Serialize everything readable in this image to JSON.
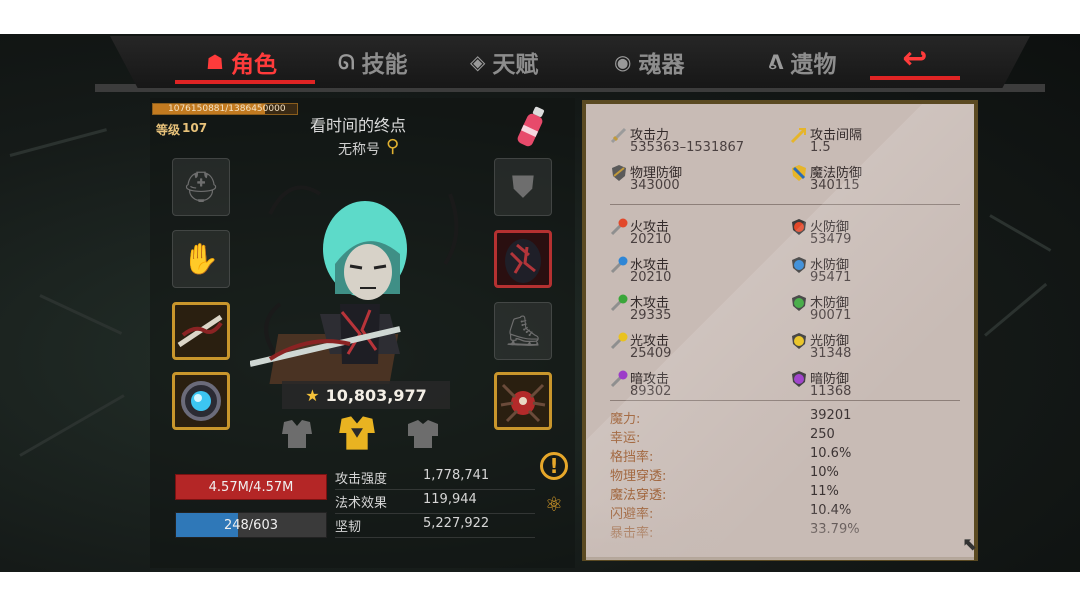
{
  "tabs": [
    {
      "label": "角色",
      "icon": "demon-face-icon",
      "active": true
    },
    {
      "label": "技能",
      "icon": "skill-swirl-icon",
      "active": false
    },
    {
      "label": "天赋",
      "icon": "talent-crystal-icon",
      "active": false
    },
    {
      "label": "魂器",
      "icon": "soul-orb-icon",
      "active": false
    },
    {
      "label": "遗物",
      "icon": "relic-flame-icon",
      "active": false
    }
  ],
  "back_icon": "back-arrow-icon",
  "character": {
    "xp_text": "1076150881/1386450000",
    "xp_fraction": 0.776,
    "level_label": "等级",
    "level": "107",
    "name": "看时间的终点",
    "title": "无称号",
    "power": "10,803,977"
  },
  "bars": {
    "hp": "4.57M/4.57M",
    "mp": "248/603",
    "mp_fraction": 0.411
  },
  "combat_stats": [
    {
      "label": "攻击强度",
      "value": "1,778,741"
    },
    {
      "label": "法术效果",
      "value": "119,944"
    },
    {
      "label": "坚韧",
      "value": "5,227,922"
    }
  ],
  "attributes_main": [
    {
      "label": "攻击力",
      "value": "535363–1531867",
      "icon": "sword-icon"
    },
    {
      "label": "攻击间隔",
      "value": "1.5",
      "icon": "swift-sword-icon"
    },
    {
      "label": "物理防御",
      "value": "343000",
      "icon": "shield-icon"
    },
    {
      "label": "魔法防御",
      "value": "340115",
      "icon": "magic-shield-icon"
    }
  ],
  "attributes_elem": [
    {
      "label": "火攻击",
      "value": "20210",
      "icon": "fire-attack-icon",
      "color": "#e2482a"
    },
    {
      "label": "火防御",
      "value": "53479",
      "icon": "fire-defense-icon",
      "color": "#e2482a"
    },
    {
      "label": "水攻击",
      "value": "20210",
      "icon": "water-attack-icon",
      "color": "#2e86d6"
    },
    {
      "label": "水防御",
      "value": "95471",
      "icon": "water-defense-icon",
      "color": "#2e86d6"
    },
    {
      "label": "木攻击",
      "value": "29335",
      "icon": "wood-attack-icon",
      "color": "#3aa63a"
    },
    {
      "label": "木防御",
      "value": "90071",
      "icon": "wood-defense-icon",
      "color": "#3aa63a"
    },
    {
      "label": "光攻击",
      "value": "25409",
      "icon": "light-attack-icon",
      "color": "#e9c21e"
    },
    {
      "label": "光防御",
      "value": "31348",
      "icon": "light-defense-icon",
      "color": "#e9c21e"
    },
    {
      "label": "暗攻击",
      "value": "89302",
      "icon": "dark-attack-icon",
      "color": "#9c3cc9"
    },
    {
      "label": "暗防御",
      "value": "11368",
      "icon": "dark-defense-icon",
      "color": "#9c3cc9"
    }
  ],
  "misc_stats": [
    {
      "label": "魔力:",
      "value": "39201"
    },
    {
      "label": "幸运:",
      "value": "250"
    },
    {
      "label": "格挡率:",
      "value": "10.6%"
    },
    {
      "label": "物理穿透:",
      "value": "10%"
    },
    {
      "label": "魔法穿透:",
      "value": "11%"
    },
    {
      "label": "闪避率:",
      "value": "10.4%"
    },
    {
      "label": "暴击率:",
      "value": "33.79%"
    }
  ],
  "colors": {
    "accent_red": "#e02424",
    "panel": "#c8bbb5",
    "gold": "#c9962c"
  }
}
